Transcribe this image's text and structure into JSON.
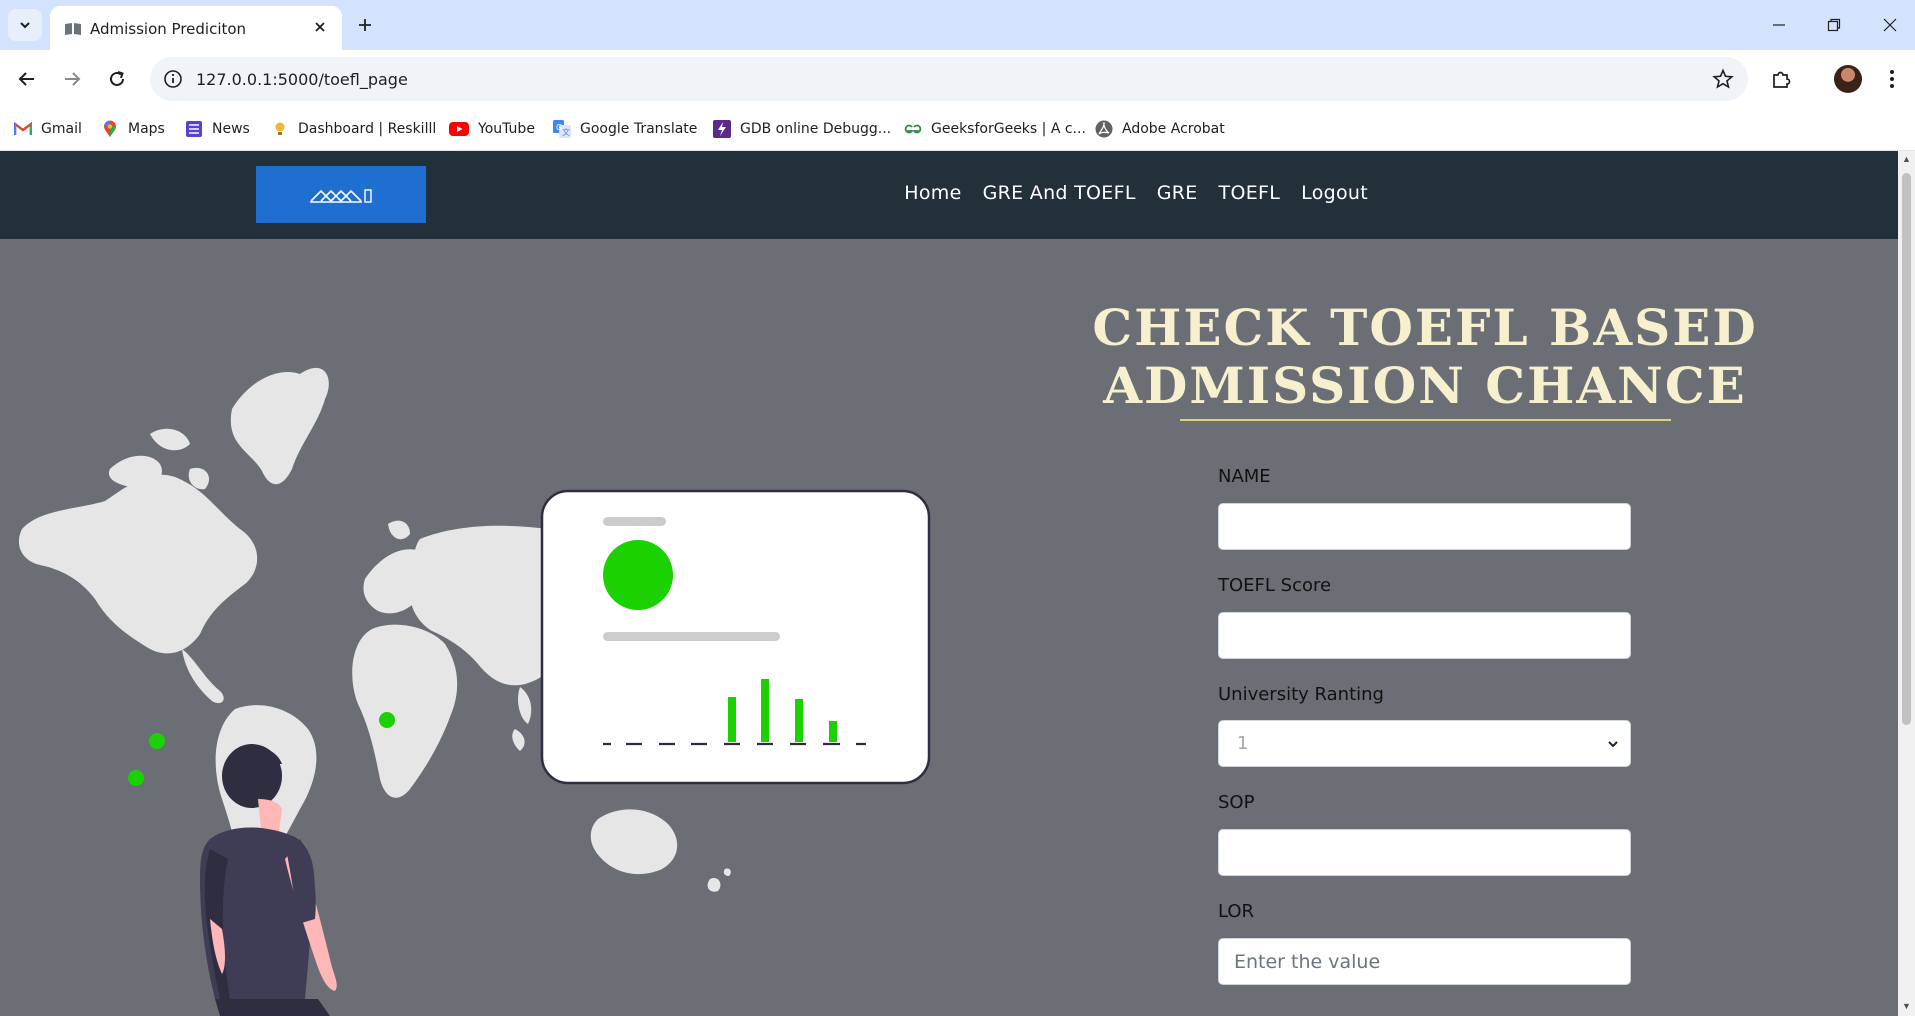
{
  "browser": {
    "tab_title": "Admission Prediciton",
    "url": "127.0.0.1:5000/toefl_page",
    "bookmarks": [
      {
        "label": "Gmail",
        "icon": "gmail-icon"
      },
      {
        "label": "Maps",
        "icon": "maps-icon"
      },
      {
        "label": "News",
        "icon": "news-icon"
      },
      {
        "label": "Dashboard | Reskilll",
        "icon": "reskilll-icon"
      },
      {
        "label": "YouTube",
        "icon": "youtube-icon"
      },
      {
        "label": "Google Translate",
        "icon": "translate-icon"
      },
      {
        "label": "GDB online Debugg...",
        "icon": "gdb-icon"
      },
      {
        "label": "GeeksforGeeks | A c...",
        "icon": "geeksforgeeks-icon"
      },
      {
        "label": "Adobe Acrobat",
        "icon": "acrobat-icon"
      }
    ]
  },
  "navbar": {
    "links": [
      "Home",
      "GRE And TOEFL",
      "GRE",
      "TOEFL",
      "Logout"
    ]
  },
  "main": {
    "heading": "CHECK TOEFL BASED ADMISSION CHANCE"
  },
  "form": {
    "name_label": "NAME",
    "name_value": "",
    "toefl_label": "TOEFL Score",
    "toefl_value": "",
    "rating_label": "University Ranting",
    "rating_value": "1",
    "sop_label": "SOP",
    "sop_value": "",
    "lor_label": "LOR",
    "lor_placeholder": "Enter the value"
  },
  "colors": {
    "navbar": "#22303a",
    "brand": "#1e6fd0",
    "page_bg": "#6b6f75",
    "heading": "#f6f0cf",
    "accent_green": "#1bd100"
  }
}
